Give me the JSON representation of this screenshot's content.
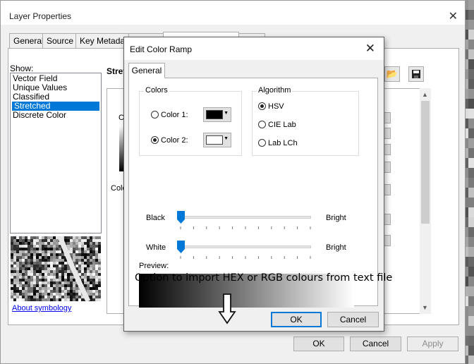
{
  "layer_properties": {
    "title": "Layer Properties",
    "tabs": [
      "General",
      "Source",
      "Key Metadata"
    ],
    "show_label": "Show:",
    "renderers": [
      "Vector Field",
      "Unique Values",
      "Classified",
      "Stretched",
      "Discrete Color"
    ],
    "selected_renderer": "Stretched",
    "panel_label_fragment": "Stret",
    "fragment_c": "C",
    "fragment_colo": "Colo",
    "about_link": "About symbology",
    "buttons": {
      "ok": "OK",
      "cancel": "Cancel",
      "apply": "Apply"
    }
  },
  "edit_color_ramp": {
    "title": "Edit Color Ramp",
    "tab": "General",
    "colors_group": {
      "label": "Colors",
      "color1_label": "Color 1:",
      "color2_label": "Color 2:",
      "selected": "Color 2:",
      "color1_swatch": "#000000",
      "color2_swatch": "#ffffff"
    },
    "algorithm_group": {
      "label": "Algorithm",
      "options": [
        "HSV",
        "CIE Lab",
        "Lab LCh"
      ],
      "selected": "HSV"
    },
    "sliders": [
      {
        "left_label": "Black",
        "right_label": "Bright",
        "value": 0
      },
      {
        "left_label": "White",
        "right_label": "Bright",
        "value": 0
      }
    ],
    "preview_label": "Preview:",
    "preview_from": "#000000",
    "preview_to": "#ffffff",
    "annotation": "Option to import HEX or RGB colours from text file",
    "buttons": {
      "ok": "OK",
      "cancel": "Cancel"
    }
  },
  "colors": {
    "accent": "#0078d7",
    "selection": "#0078d7"
  }
}
